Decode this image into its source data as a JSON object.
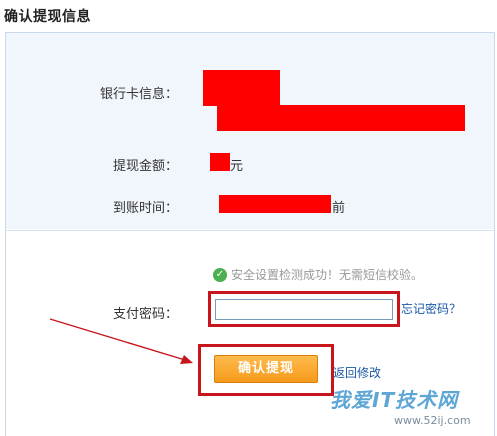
{
  "header": {
    "title": "确认提现信息"
  },
  "info": {
    "bank_card_label": "银行卡信息：",
    "amount_label": "提现金额：",
    "amount_suffix": "元",
    "arrival_label": "到账时间：",
    "arrival_suffix": "前"
  },
  "form": {
    "security_message": "安全设置检测成功！无需短信校验。",
    "password_label": "支付密码：",
    "password_value": "",
    "forgot_password_link": "忘记密码？",
    "confirm_button": "确认提现",
    "back_link": "返回修改"
  },
  "watermark": {
    "brand": "我爱IT技术网",
    "url": "www.52ij.com"
  },
  "colors": {
    "annotation_red": "#c8151b",
    "redaction_red": "#ff0000",
    "button_orange": "#f59a1b",
    "link_blue": "#1a58a6",
    "success_green": "#4caf50"
  }
}
